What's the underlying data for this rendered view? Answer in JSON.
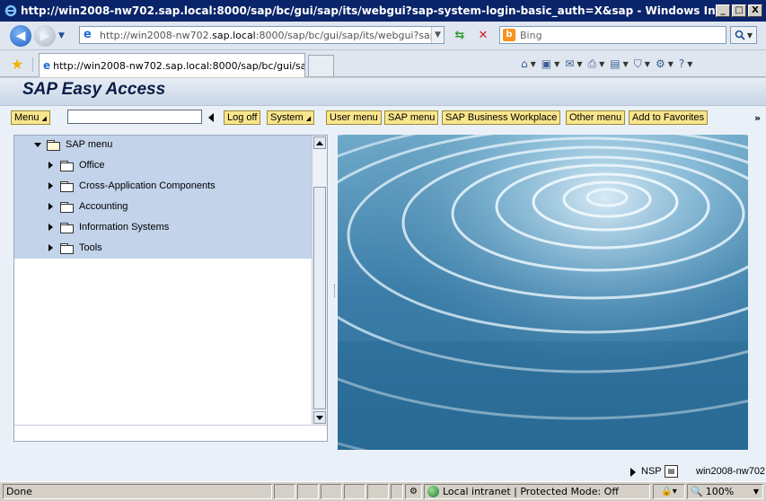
{
  "window": {
    "title": "http://win2008-nw702.sap.local:8000/sap/bc/gui/sap/its/webgui?sap-system-login-basic_auth=X&sap - Windows Internet Explorer",
    "min": "_",
    "max": "□",
    "close": "X"
  },
  "address_bar": {
    "url_prefix": "http://win2008-nw702.",
    "url_domain": "sap.local",
    "url_suffix": ":8000/sap/bc/gui/sap/its/webgui?sap-system",
    "search_placeholder": "Bing"
  },
  "tab": {
    "label": "http://win2008-nw702.sap.local:8000/sap/bc/gui/sap..."
  },
  "sap": {
    "title": "SAP Easy Access",
    "toolbar": {
      "menu": "Menu",
      "log_off": "Log off",
      "system": "System",
      "user_menu": "User menu",
      "sap_menu": "SAP menu",
      "business_workplace": "SAP Business Workplace",
      "other_menu": "Other menu",
      "add_favorites": "Add to Favorites",
      "more": "»"
    },
    "tree": {
      "root": "SAP menu",
      "items": [
        {
          "label": "Office"
        },
        {
          "label": "Cross-Application Components"
        },
        {
          "label": "Accounting"
        },
        {
          "label": "Information Systems"
        },
        {
          "label": "Tools"
        }
      ]
    },
    "status": {
      "system": "NSP",
      "host": "win2008-nw702"
    }
  },
  "ie_status": {
    "done": "Done",
    "zone": "Local intranet | Protected Mode: Off",
    "zoom": "100%"
  }
}
